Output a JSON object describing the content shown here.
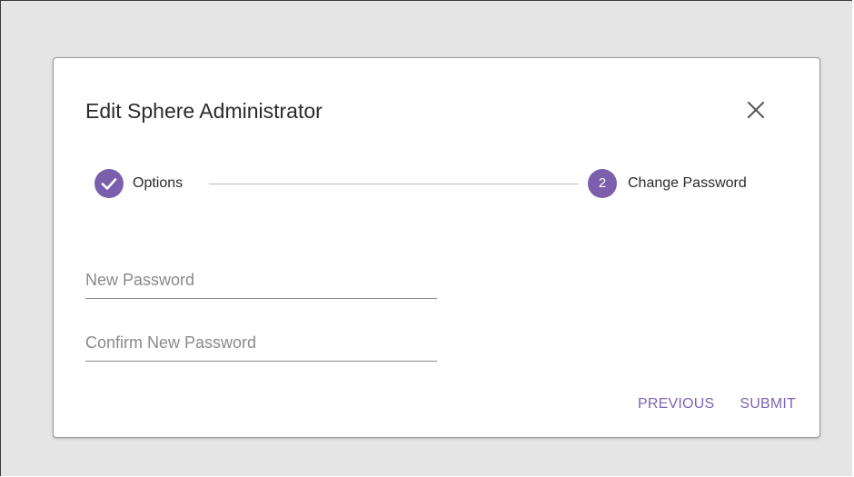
{
  "dialog": {
    "title": "Edit Sphere Administrator"
  },
  "stepper": {
    "steps": [
      {
        "label": "Options",
        "state": "completed",
        "icon": "check-icon"
      },
      {
        "label": "Change Password",
        "state": "active",
        "number": "2"
      }
    ]
  },
  "form": {
    "new_password": {
      "placeholder": "New Password",
      "value": ""
    },
    "confirm_password": {
      "placeholder": "Confirm New Password",
      "value": ""
    }
  },
  "actions": {
    "previous_label": "PREVIOUS",
    "submit_label": "SUBMIT"
  },
  "colors": {
    "accent": "#7b5fac",
    "button_text": "#7e64b4",
    "backdrop": "#e5e5e5"
  }
}
